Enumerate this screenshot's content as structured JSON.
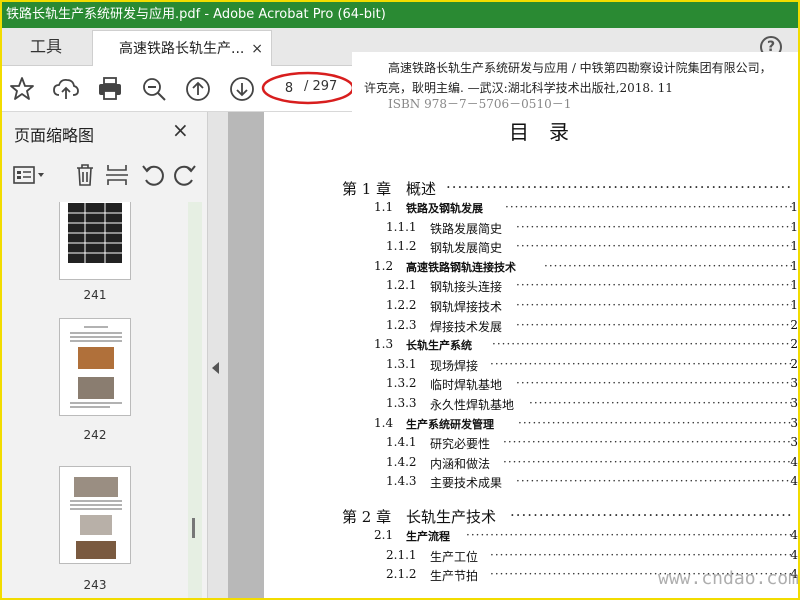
{
  "window": {
    "title": "铁路长轨生产系统研发与应用.pdf - Adobe Acrobat Pro (64-bit)"
  },
  "tabs": {
    "tools_label": "工具",
    "doc_label": "高速铁路长轨生产...",
    "close": "×",
    "help": "?"
  },
  "toolbar": {
    "icons": [
      "star-icon",
      "cloud-upload-icon",
      "print-icon",
      "zoom-out-icon",
      "page-up-icon",
      "page-down-icon"
    ],
    "current_page": "8",
    "total_pages": "/ 297"
  },
  "citation": {
    "line1": "高速铁路长轨生产系统研发与应用 / 中铁第四勘察设计院集团有限公司，",
    "line2": "许克亮，耿明主编. —武汉:湖北科学技术出版社,2018. 11",
    "line3": "ISBN   978－7－5706－0510－1"
  },
  "sidebar": {
    "title": "页面缩略图",
    "close": "×",
    "thumbnails": [
      {
        "label": "241"
      },
      {
        "label": "242"
      },
      {
        "label": "243"
      }
    ]
  },
  "toc": {
    "title": "目录",
    "entries": [
      {
        "level": "chapter",
        "num": "第 1 章",
        "text": "概述",
        "page": ""
      },
      {
        "level": "section",
        "num": "1.1",
        "text": "铁路及钢轨发展",
        "page": "1"
      },
      {
        "level": "sub",
        "num": "1.1.1",
        "text": "铁路发展简史",
        "page": "1"
      },
      {
        "level": "sub",
        "num": "1.1.2",
        "text": "钢轨发展简史",
        "page": "1"
      },
      {
        "level": "section",
        "num": "1.2",
        "text": "高速铁路钢轨连接技术",
        "page": "1"
      },
      {
        "level": "sub",
        "num": "1.2.1",
        "text": "钢轨接头连接",
        "page": "1"
      },
      {
        "level": "sub",
        "num": "1.2.2",
        "text": "钢轨焊接技术",
        "page": "1"
      },
      {
        "level": "sub",
        "num": "1.2.3",
        "text": "焊接技术发展",
        "page": "2"
      },
      {
        "level": "section",
        "num": "1.3",
        "text": "长轨生产系统",
        "page": "2"
      },
      {
        "level": "sub",
        "num": "1.3.1",
        "text": "现场焊接",
        "page": "2"
      },
      {
        "level": "sub",
        "num": "1.3.2",
        "text": "临时焊轨基地",
        "page": "3"
      },
      {
        "level": "sub",
        "num": "1.3.3",
        "text": "永久性焊轨基地",
        "page": "3"
      },
      {
        "level": "section",
        "num": "1.4",
        "text": "生产系统研发管理",
        "page": "3"
      },
      {
        "level": "sub",
        "num": "1.4.1",
        "text": "研究必要性",
        "page": "3"
      },
      {
        "level": "sub",
        "num": "1.4.2",
        "text": "内涵和做法",
        "page": "4"
      },
      {
        "level": "sub",
        "num": "1.4.3",
        "text": "主要技术成果",
        "page": "4"
      },
      {
        "level": "chapter",
        "num": "第 2 章",
        "text": "长轨生产技术",
        "page": ""
      },
      {
        "level": "section",
        "num": "2.1",
        "text": "生产流程",
        "page": "4"
      },
      {
        "level": "sub",
        "num": "2.1.1",
        "text": "生产工位",
        "page": "4"
      },
      {
        "level": "sub",
        "num": "2.1.2",
        "text": "生产节拍",
        "page": "4"
      }
    ]
  },
  "watermark": "www.cndao.com",
  "colors": {
    "titlebar": "#2a8a33",
    "frame": "#f2dc00",
    "highlight": "#d81e1e"
  }
}
